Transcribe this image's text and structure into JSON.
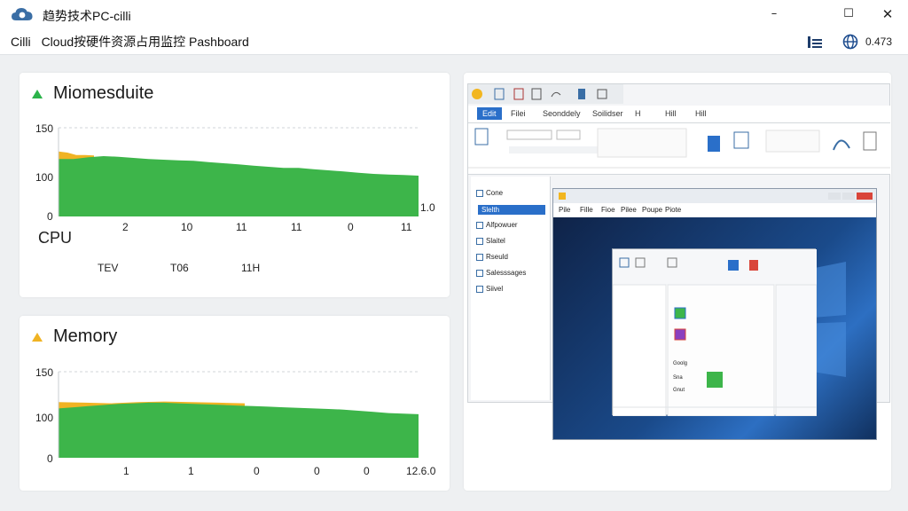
{
  "window": {
    "title": "趋势技术PC-cilli",
    "minimize": "–",
    "maximize": "☐",
    "close": "✕"
  },
  "header": {
    "title_left": "Cilli",
    "title_right": "Cloud按硬件资源占用监控 Pashboard",
    "value": "0.473",
    "icons": [
      "bar-chart-icon",
      "globe-icon"
    ]
  },
  "cpu_card": {
    "title": "Miomesduite",
    "y_ticks": [
      "150",
      "100",
      "0"
    ],
    "x_ticks": [
      "2",
      "10",
      "11",
      "11",
      "0",
      "11"
    ],
    "end_label": "1.0",
    "axis_name": "CPU",
    "sub_labels": [
      "TEV",
      "T06",
      "11H"
    ]
  },
  "memory_card": {
    "title": "Memory",
    "y_ticks": [
      "150",
      "100",
      "0"
    ],
    "x_ticks": [
      "1",
      "1",
      "0",
      "0",
      "0"
    ],
    "end_label": "12.6.0"
  },
  "colors": {
    "green": "#3db54a",
    "yellow": "#f0b323",
    "accent": "#2a6fc9"
  },
  "chart_data": [
    {
      "type": "area",
      "title": "Miomesduite",
      "ylim": [
        0,
        150
      ],
      "series": [
        {
          "color": "#f0b323",
          "values": [
            110,
            108,
            104,
            104,
            103
          ]
        },
        {
          "color": "#3db54a",
          "values": [
            97,
            97,
            100,
            102,
            101,
            99,
            97,
            96,
            95,
            94,
            92,
            90,
            88,
            86,
            84,
            82,
            82,
            80,
            78,
            76,
            74,
            72,
            71,
            70,
            69
          ]
        }
      ]
    },
    {
      "type": "area",
      "title": "Memory",
      "ylim": [
        0,
        150
      ],
      "series": [
        {
          "color": "#f0b323",
          "values": [
            97,
            96,
            95,
            97,
            98,
            97,
            96,
            95
          ]
        },
        {
          "color": "#3db54a",
          "values": [
            86,
            88,
            90,
            92,
            94,
            95,
            96,
            96,
            95,
            94,
            93,
            92,
            91,
            90,
            89,
            88,
            87,
            86,
            85,
            84,
            82,
            80,
            78,
            77,
            76
          ]
        }
      ]
    }
  ],
  "screenshot": {
    "tabs": [
      "Edit",
      "Filei",
      "Seonddely",
      "Soilidser",
      "H",
      "Hill",
      "Hill"
    ],
    "nav_items": [
      "Cone",
      "Slelth",
      "Alfpowuer",
      "Slaitel",
      "Rseuld",
      "Salesssages",
      "Siivel"
    ],
    "inner_tabs": [
      "Pile",
      "Fille",
      "Fioe",
      "Pilee",
      "Poupe",
      "Piote"
    ],
    "dialog_rows": [
      "Goolg",
      "Sna",
      "Gnut"
    ]
  }
}
